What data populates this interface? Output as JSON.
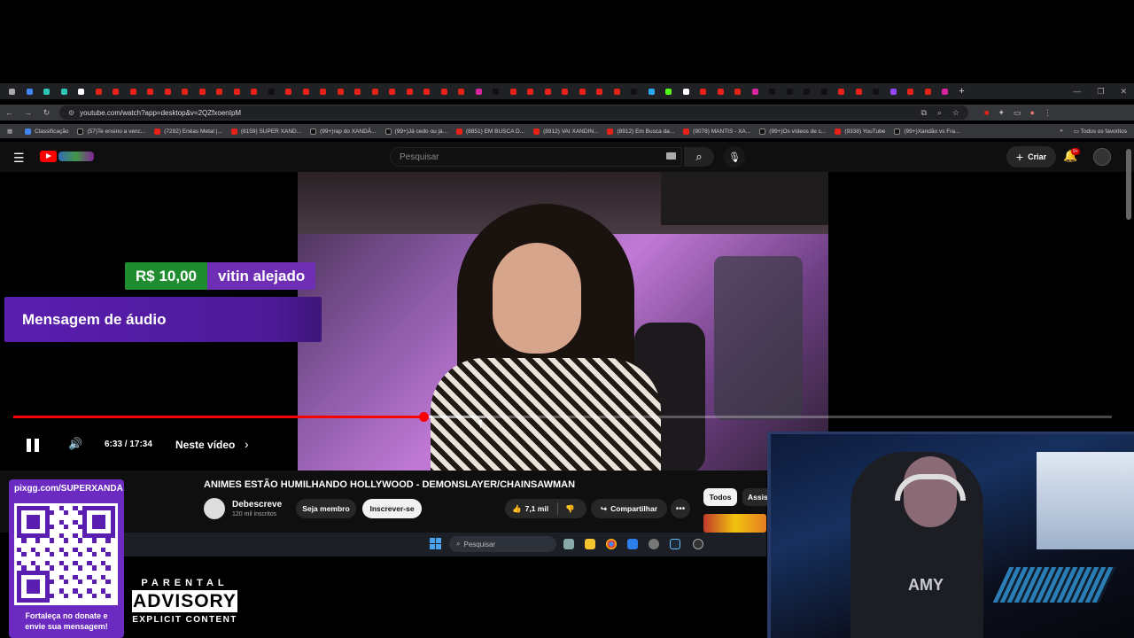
{
  "browser": {
    "url": "youtube.com/watch?app=desktop&v=2QZfxoenIpM",
    "tab_colors": [
      "#aaa",
      "#4285f4",
      "#2ec4b6",
      "#2ec4b6",
      "#fff",
      "#e62117",
      "#e62117",
      "#e62117",
      "#e62117",
      "#e62117",
      "#e62117",
      "#e62117",
      "#e62117",
      "#e62117",
      "#e62117",
      "#111",
      "#e62117",
      "#e62117",
      "#e62117",
      "#e62117",
      "#e62117",
      "#e62117",
      "#e62117",
      "#e62117",
      "#e62117",
      "#e62117",
      "#e62117",
      "#d6249f",
      "#111",
      "#e62117",
      "#e62117",
      "#e62117",
      "#e62117",
      "#e62117",
      "#e62117",
      "#e62117",
      "#111",
      "#29a9eb",
      "#53fc18",
      "#fff",
      "#e62117",
      "#e62117",
      "#e62117",
      "#d6249f",
      "#111",
      "#111",
      "#111",
      "#111",
      "#e62117",
      "#e62117",
      "#111",
      "#9146ff",
      "#e62117",
      "#e62117",
      "#d6249f"
    ],
    "bookmarks": [
      {
        "label": "Classificação",
        "type": "b"
      },
      {
        "label": "(57)Te ensino a venc...",
        "type": "k"
      },
      {
        "label": "(7292) Enéas Metal |...",
        "type": "r"
      },
      {
        "label": "(8159) SUPER XAND...",
        "type": "r"
      },
      {
        "label": "(99+)rap do XANDÃ...",
        "type": "k"
      },
      {
        "label": "(99+)Já cedo ou já...",
        "type": "k"
      },
      {
        "label": "(8851) EM BUSCA D...",
        "type": "r"
      },
      {
        "label": "(8912) VAI XANDIN...",
        "type": "r"
      },
      {
        "label": "(8912) Em Busca da...",
        "type": "r"
      },
      {
        "label": "(9078) MANTIS - XA...",
        "type": "r"
      },
      {
        "label": "(99+)Os vídeos de c...",
        "type": "k"
      },
      {
        "label": "(9338) YouTube",
        "type": "r"
      },
      {
        "label": "(99+)Xandão vs Fra...",
        "type": "k"
      }
    ],
    "bookmarks_all": "Todos os favoritos",
    "chevron": "»"
  },
  "youtube": {
    "search_placeholder": "Pesquisar",
    "create_label": "Criar",
    "notifications_badge": "9+"
  },
  "player": {
    "time": "6:33 / 17:34",
    "chapter_label": "Neste vídeo",
    "progress_fraction": 0.373,
    "buffer_fraction": 0.43
  },
  "donation": {
    "amount": "R$ 10,00",
    "user": "vitin alejado",
    "message": "Mensagem de áudio"
  },
  "video": {
    "title": "ANIMES ESTÃO HUMILHANDO HOLLYWOOD - DEMONSLAYER/CHAINSAWMAN",
    "channel": "Debescreve",
    "subscribers": "120 mil inscritos",
    "member_label": "Seja membro",
    "subscribe_label": "Inscrever-se",
    "likes": "7,1 mil",
    "share_label": "Compartilhar",
    "more_label": "•••",
    "chip_all": "Todos",
    "chip_assis": "Assis"
  },
  "taskbar": {
    "search_placeholder": "Pesquisar"
  },
  "overlay": {
    "qr_url": "pixgg.com/SUPERXANDÃ",
    "qr_caption_1": "Fortaleça no donate e",
    "qr_caption_2": "envie sua mensagem!",
    "advisory_1": "PARENTAL",
    "advisory_2": "ADVISORY",
    "advisory_3": "EXPLICIT CONTENT"
  },
  "webcam": {
    "shirt_text": "AMY"
  }
}
